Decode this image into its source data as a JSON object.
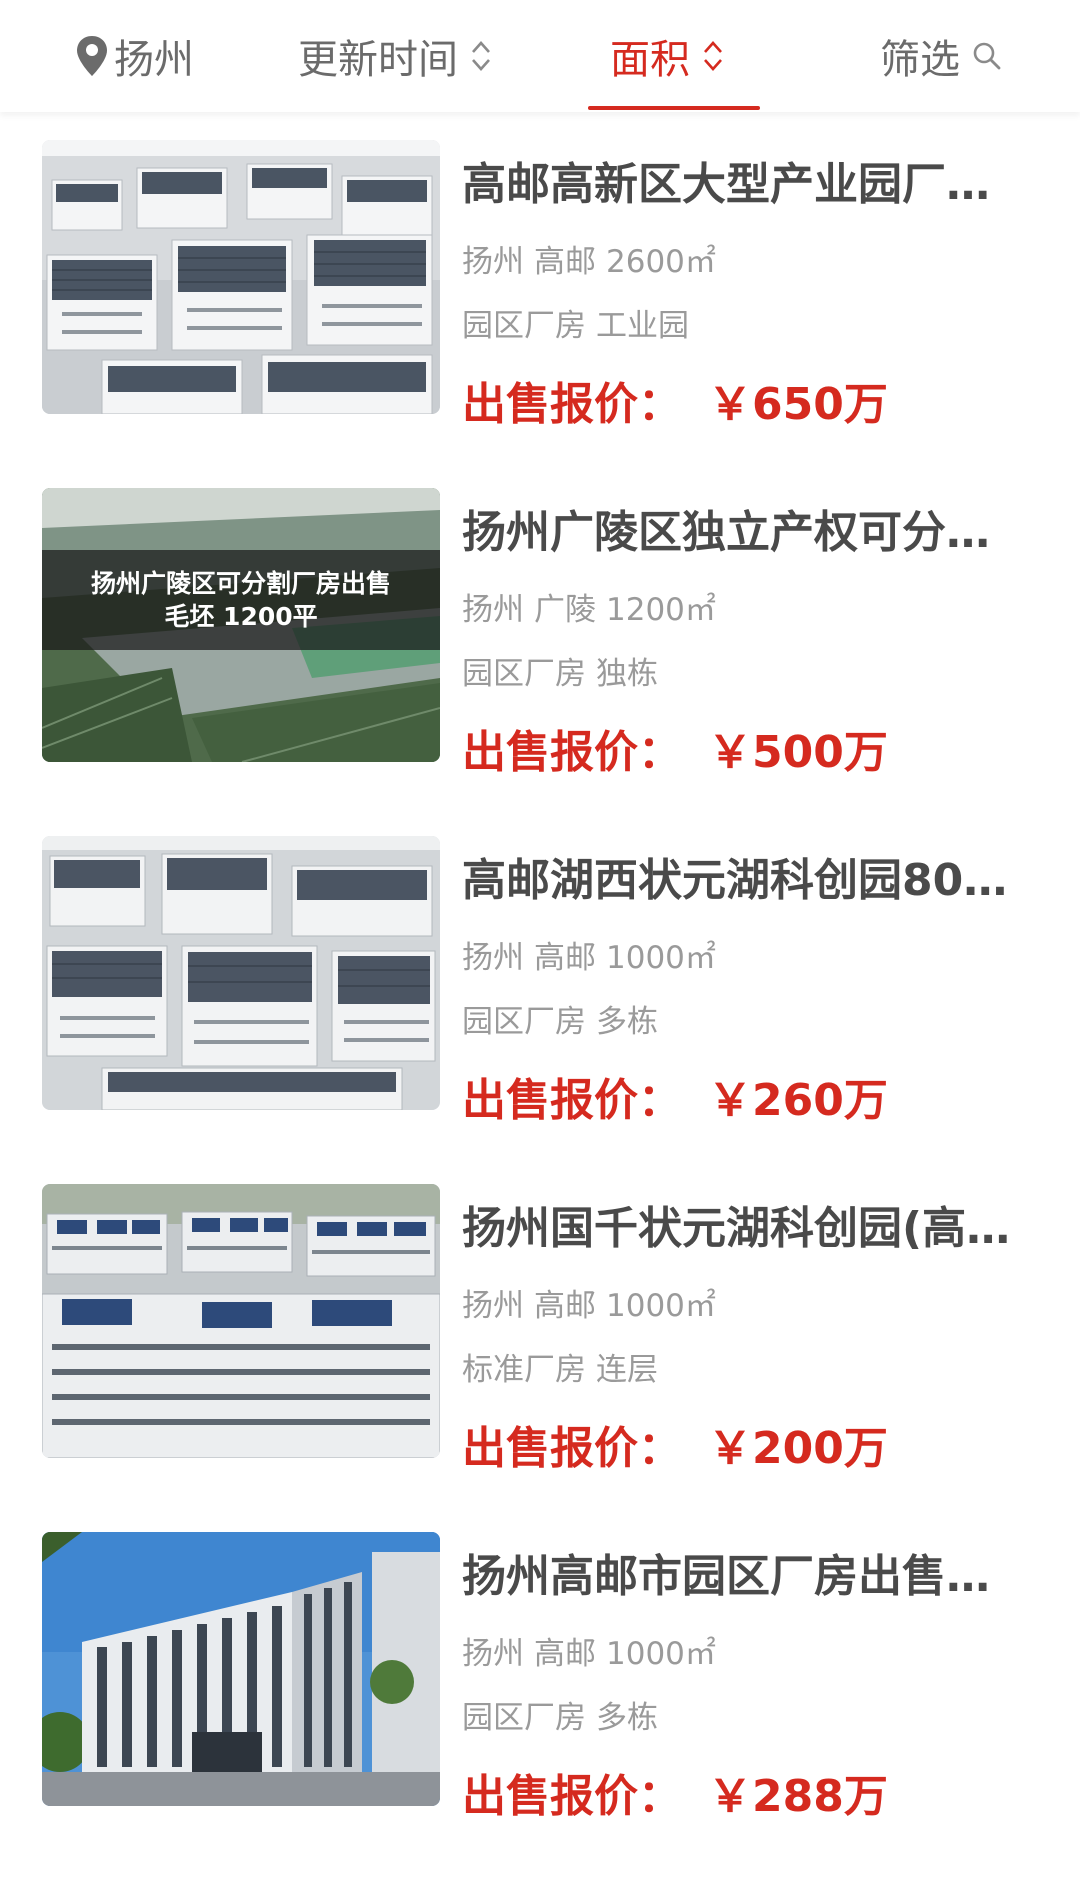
{
  "filter_bar": {
    "location": "扬州",
    "update_time": "更新时间",
    "area": "面积",
    "filter": "筛选"
  },
  "accent_color": "#d52a1f",
  "listings": [
    {
      "title": "高邮高新区大型产业园厂…",
      "city": "扬州",
      "district": "高邮",
      "area": "2600㎡",
      "type": "园区厂房",
      "style": "工业园",
      "price_label": "出售报价：",
      "price": "￥650万",
      "image": "solar-rooftop-industrial-park-photo"
    },
    {
      "title": "扬州广陵区独立产权可分…",
      "city": "扬州",
      "district": "广陵",
      "area": "1200㎡",
      "type": "园区厂房",
      "style": "独栋",
      "price_label": "出售报价：",
      "price": "￥500万",
      "image": "aerial-factory-green-fields-photo",
      "image_caption_1": "扬州广陵区可分割厂房出售",
      "image_caption_2": "毛坯  1200平"
    },
    {
      "title": "高邮湖西状元湖科创园80…",
      "city": "扬州",
      "district": "高邮",
      "area": "1000㎡",
      "type": "园区厂房",
      "style": "多栋",
      "price_label": "出售报价：",
      "price": "￥260万",
      "image": "solar-rooftop-industrial-park-photo"
    },
    {
      "title": "扬州国千状元湖科创园(高…",
      "city": "扬州",
      "district": "高邮",
      "area": "1000㎡",
      "type": "标准厂房",
      "style": "连层",
      "price_label": "出售报价：",
      "price": "￥200万",
      "image": "blue-solar-roof-park-model-photo"
    },
    {
      "title": "扬州高邮市园区厂房出售…",
      "city": "扬州",
      "district": "高邮",
      "area": "1000㎡",
      "type": "园区厂房",
      "style": "多栋",
      "price_label": "出售报价：",
      "price": "￥288万",
      "image": "factory-building-rendering-photo"
    }
  ]
}
